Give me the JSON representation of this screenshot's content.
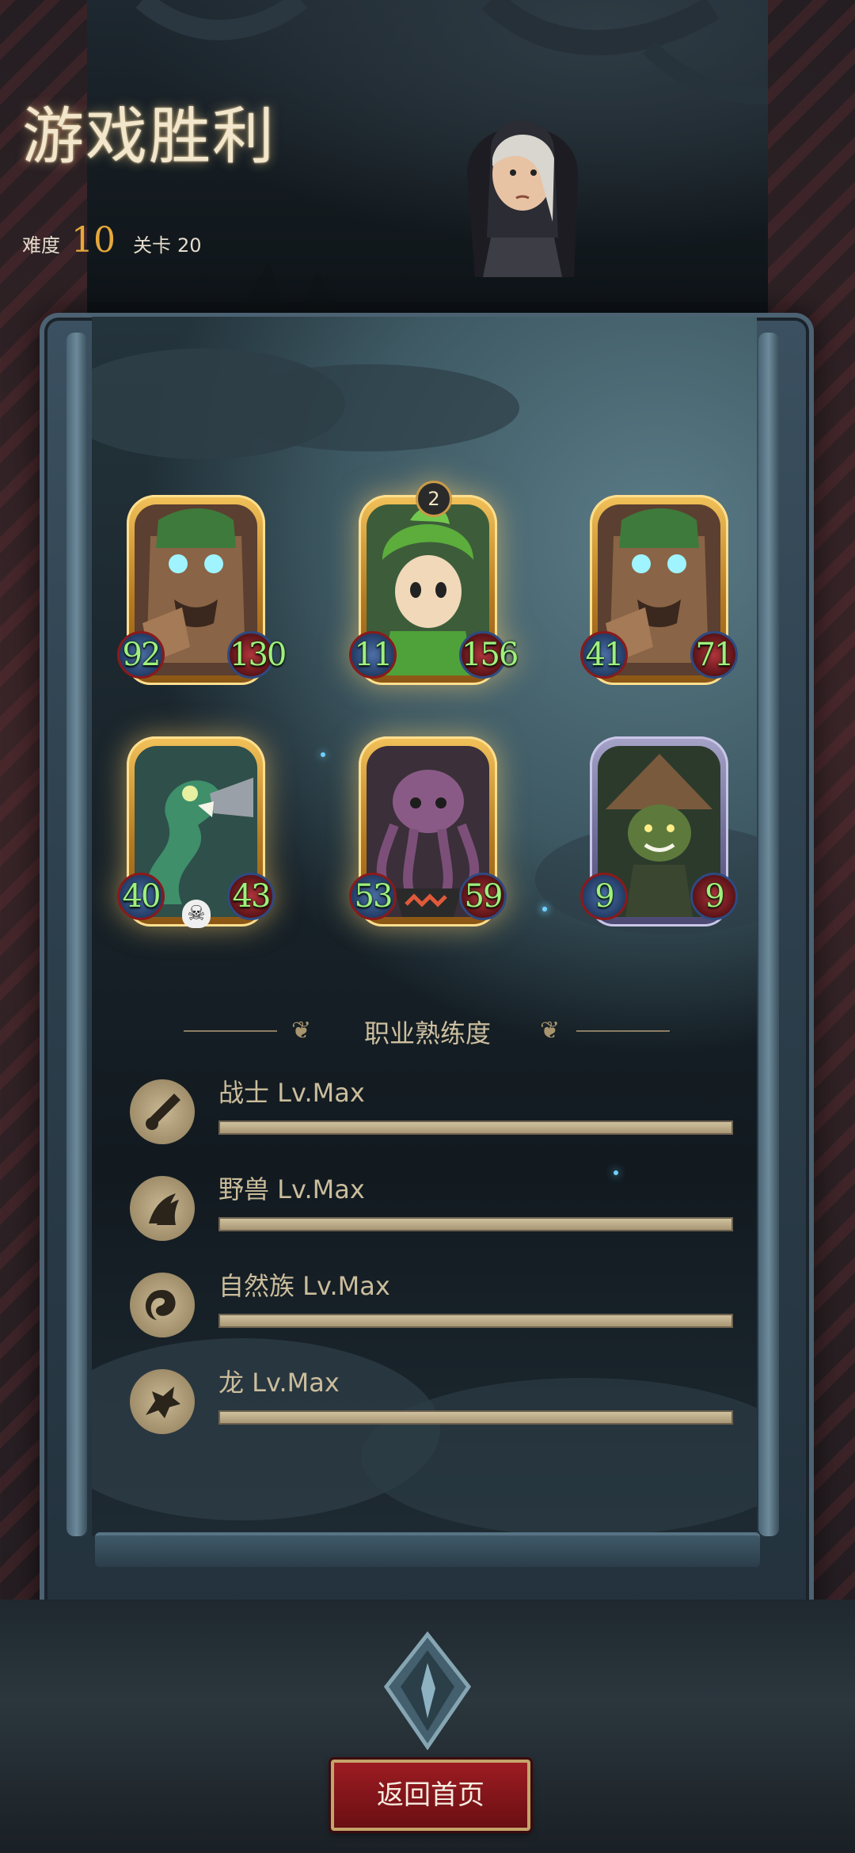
{
  "header": {
    "title": "游戏胜利",
    "difficulty_label": "难度",
    "difficulty_value": "10",
    "stage_label": "关卡",
    "stage_value": "20"
  },
  "team": [
    {
      "name": "treant",
      "atk": "92",
      "hp": "130",
      "frame": "gold",
      "badge": ""
    },
    {
      "name": "leaf-sprite",
      "atk": "11",
      "hp": "156",
      "frame": "gold",
      "badge": "2"
    },
    {
      "name": "treant",
      "atk": "41",
      "hp": "71",
      "frame": "gold",
      "badge": ""
    },
    {
      "name": "sea-serpent",
      "atk": "40",
      "hp": "43",
      "frame": "gold",
      "badge": ""
    },
    {
      "name": "octopus",
      "atk": "53",
      "hp": "59",
      "frame": "gold",
      "badge": ""
    },
    {
      "name": "goblin",
      "atk": "9",
      "hp": "9",
      "frame": "silver",
      "badge": ""
    }
  ],
  "mastery": {
    "title": "职业熟练度",
    "items": [
      {
        "label": "战士 Lv.Max",
        "icon": "sword-icon",
        "progress": 1.0
      },
      {
        "label": "野兽 Lv.Max",
        "icon": "claw-icon",
        "progress": 1.0
      },
      {
        "label": "自然族 Lv.Max",
        "icon": "swirl-icon",
        "progress": 1.0
      },
      {
        "label": "龙 Lv.Max",
        "icon": "dragon-icon",
        "progress": 1.0
      }
    ]
  },
  "buttons": {
    "return_home": "返回首页"
  },
  "colors": {
    "stat_text": "#9ff07d",
    "difficulty_accent": "#e7a83b",
    "button_red": "#9c1c22"
  }
}
